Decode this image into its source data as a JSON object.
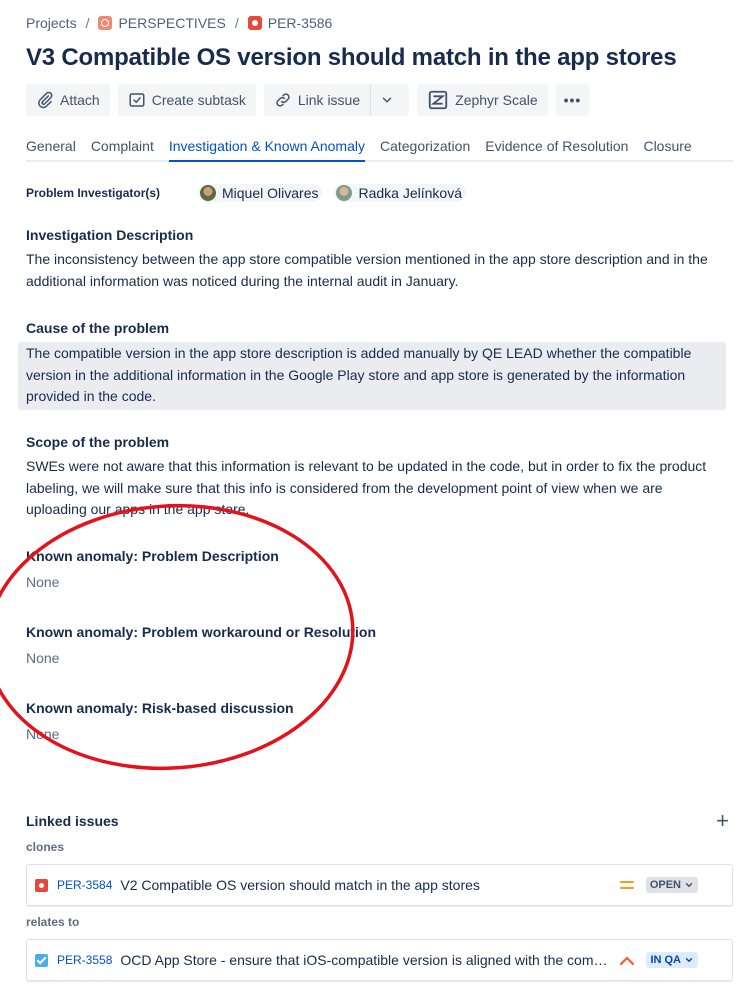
{
  "breadcrumb": {
    "projects": "Projects",
    "project": "PERSPECTIVES",
    "issue_key": "PER-3586",
    "sep": "/"
  },
  "issue": {
    "title": "V3 Compatible OS version should match in the app stores"
  },
  "toolbar": {
    "attach": "Attach",
    "create_subtask": "Create subtask",
    "link_issue": "Link issue",
    "zephyr": "Zephyr Scale",
    "more": "•••"
  },
  "tabs": [
    {
      "label": "General"
    },
    {
      "label": "Complaint"
    },
    {
      "label": "Investigation & Known Anomaly",
      "active": true
    },
    {
      "label": "Categorization"
    },
    {
      "label": "Evidence of Resolution"
    },
    {
      "label": "Closure"
    }
  ],
  "investigators": {
    "label": "Problem Investigator(s)",
    "people": [
      "Miquel Olivares",
      "Radka Jelínková"
    ]
  },
  "fields": {
    "investigation_description": {
      "label": "Investigation Description",
      "value": "The inconsistency between the app store compatible version mentioned in the app store description and in the additional information was noticed during the internal audit in January."
    },
    "cause": {
      "label": "Cause of the problem",
      "value": "The compatible version in the app store description is added manually by QE LEAD whether the compatible version in the additional information in the Google Play store and app store is generated by the information provided in the code."
    },
    "scope": {
      "label": "Scope of the problem",
      "value": "SWEs were not aware that this information is relevant to be updated in the code, but in order to fix the product labeling, we will make sure that this info is considered from the development point of view when we are uploading our apps in the app store."
    },
    "ka_description": {
      "label": "Known anomaly: Problem Description",
      "value": "None"
    },
    "ka_workaround": {
      "label": "Known anomaly: Problem workaround or Resolution",
      "value": "None"
    },
    "ka_risk": {
      "label": "Known anomaly: Risk-based discussion",
      "value": "None"
    }
  },
  "linked_issues": {
    "title": "Linked issues",
    "add": "+",
    "groups": [
      {
        "relation": "clones",
        "issue": {
          "type": "bug",
          "key": "PER-3584",
          "summary": "V2 Compatible OS version should match in the app stores",
          "priority": "medium",
          "status": "OPEN"
        }
      },
      {
        "relation": "relates to",
        "issue": {
          "type": "task",
          "key": "PER-3558",
          "summary": "OCD App Store - ensure that iOS-compatible version is aligned with the compatible OS version",
          "priority": "high",
          "status": "IN QA"
        }
      }
    ]
  },
  "colors": {
    "accent": "#0052cc",
    "annotation": "#e3121b",
    "priority_medium": "#ff991f",
    "priority_high": "#ff5630"
  }
}
